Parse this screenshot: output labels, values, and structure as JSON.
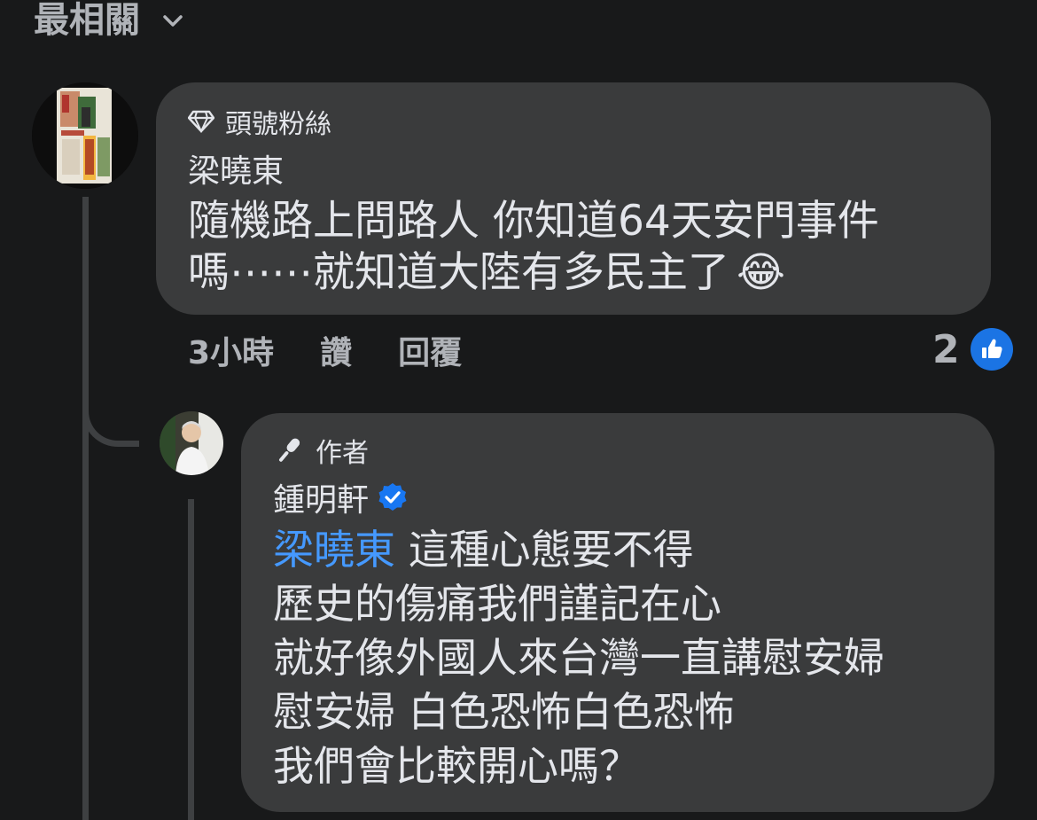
{
  "sort": {
    "label": "最相關",
    "icon": "chevron-down-icon"
  },
  "comment": {
    "badge": "頭號粉絲",
    "badge_icon": "diamond-icon",
    "author": "梁曉東",
    "text_line1": "隨機路上問路人 你知道64天安門事件",
    "text_line2": "嗎⋯⋯就知道大陸有多民主了",
    "emoji": "😂",
    "time": "3小時",
    "like_action": "讚",
    "reply_action": "回覆",
    "reaction_count": "2",
    "reaction_icon": "like-icon"
  },
  "reply": {
    "badge": "作者",
    "badge_icon": "microphone-icon",
    "author": "鍾明軒",
    "verified_icon": "verified-badge-icon",
    "mention": "梁曉東",
    "line1_rest": " 這種心態要不得",
    "line2": "歷史的傷痛我們謹記在心",
    "line3": "就好像外國人來台灣一直講慰安婦",
    "line4": "慰安婦 白色恐怖白色恐怖",
    "line5": "我們會比較開心嗎？"
  },
  "colors": {
    "background": "#18191a",
    "bubble": "#3a3b3c",
    "mention": "#4599ff",
    "like": "#1b74e4"
  }
}
